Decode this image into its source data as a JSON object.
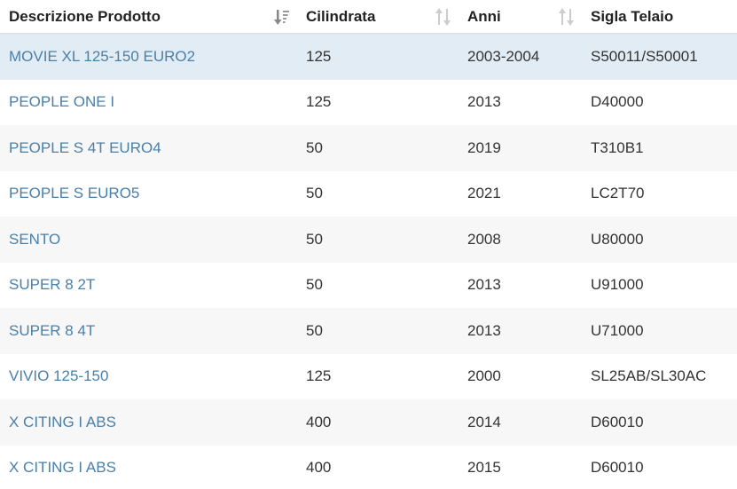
{
  "table": {
    "headers": [
      {
        "label": "Descrizione Prodotto",
        "sort": "desc-active"
      },
      {
        "label": "Cilindrata",
        "sort": "none"
      },
      {
        "label": "Anni",
        "sort": "none"
      },
      {
        "label": "Sigla Telaio",
        "sort": "hidden"
      }
    ],
    "rows": [
      [
        "MOVIE XL 125-150 EURO2",
        "125",
        "2003-2004",
        "S50011/S50001"
      ],
      [
        "PEOPLE ONE I",
        "125",
        "2013",
        "D40000"
      ],
      [
        "PEOPLE S 4T EURO4",
        "50",
        "2019",
        "T310B1"
      ],
      [
        "PEOPLE S EURO5",
        "50",
        "2021",
        "LC2T70"
      ],
      [
        "SENTO",
        "50",
        "2008",
        "U80000"
      ],
      [
        "SUPER 8 2T",
        "50",
        "2013",
        "U91000"
      ],
      [
        "SUPER 8 4T",
        "50",
        "2013",
        "U71000"
      ],
      [
        "VIVIO 125-150",
        "125",
        "2000",
        "SL25AB/SL30AC"
      ],
      [
        "X CITING I ABS",
        "400",
        "2014",
        "D60010"
      ],
      [
        "X CITING I ABS",
        "400",
        "2015",
        "D60010"
      ]
    ]
  },
  "colors": {
    "link": "#4a7fa8",
    "selected_row": "#e2ecf4",
    "stripe": "#f7f7f7"
  },
  "icons": {
    "active_sort": "sort-alpha-down-icon",
    "inactive_sort": "sort-both-icon"
  }
}
